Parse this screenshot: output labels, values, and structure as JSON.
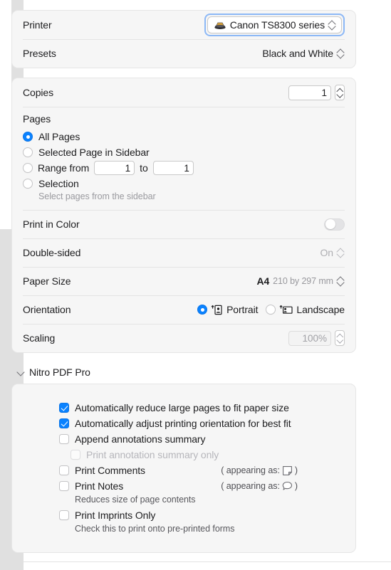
{
  "dialog": {
    "printer": {
      "label": "Printer",
      "value": "Canon TS8300 series",
      "icon": "printer-icon",
      "focused": true
    },
    "presets": {
      "label": "Presets",
      "value": "Black and White"
    },
    "copies": {
      "label": "Copies",
      "value": "1"
    },
    "pages": {
      "label": "Pages",
      "options": [
        {
          "label": "All Pages",
          "selected": true
        },
        {
          "label": "Selected Page in Sidebar",
          "selected": false
        },
        {
          "label": "Range from",
          "selected": false
        },
        {
          "label": "Selection",
          "selected": false
        }
      ],
      "range": {
        "from_value": "1",
        "to_label": "to",
        "to_value": "1"
      },
      "selection_hint": "Select pages from the sidebar"
    },
    "print_in_color": {
      "label": "Print in Color",
      "enabled": false
    },
    "double_sided": {
      "label": "Double-sided",
      "value": "On"
    },
    "paper_size": {
      "label": "Paper Size",
      "value": "A4",
      "dimensions": "210 by 297 mm"
    },
    "orientation": {
      "label": "Orientation",
      "options": [
        {
          "label": "Portrait",
          "selected": true,
          "icon": "portrait-page-icon"
        },
        {
          "label": "Landscape",
          "selected": false,
          "icon": "landscape-page-icon"
        }
      ]
    },
    "scaling": {
      "label": "Scaling",
      "value": "100%"
    },
    "nitro": {
      "title": "Nitro PDF Pro",
      "expanded": true,
      "checkboxes": [
        {
          "label": "Automatically reduce large pages to fit paper size",
          "checked": true,
          "disabled": false
        },
        {
          "label": "Automatically adjust printing orientation for best fit",
          "checked": true,
          "disabled": false
        },
        {
          "label": "Append annotations summary",
          "checked": false,
          "disabled": false
        },
        {
          "label": "Print annotation summary only",
          "checked": false,
          "disabled": true
        },
        {
          "label": "Print Comments",
          "checked": false,
          "disabled": false
        },
        {
          "label": "Print Notes",
          "checked": false,
          "disabled": false
        },
        {
          "label": "Print Imprints Only",
          "checked": false,
          "disabled": false
        }
      ],
      "appearing_prefix": "( appearing as:",
      "appearing_suffix": ")",
      "notes_hint": "Reduces size of page contents",
      "imprints_hint": "Check this to print onto pre-printed forms"
    }
  },
  "colors": {
    "accent": "#0a82ff",
    "focus_ring": "#8cb8f6",
    "card_bg": "#f6f6f6",
    "panel_bg": "#ffffff",
    "window_bg": "#e0e0e0"
  }
}
